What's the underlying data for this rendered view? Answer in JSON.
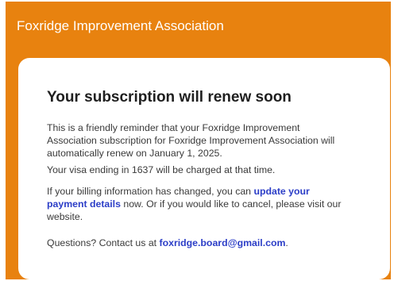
{
  "header": {
    "title": "Foxridge Improvement Association"
  },
  "card": {
    "title": "Your subscription will renew soon",
    "reminder": "This is a friendly reminder that your Foxridge Improvement Association subscription for Foxridge Improvement Association will automatically renew on January 1, 2025.",
    "charge_notice": "Your visa ending in 1637 will be charged at that time.",
    "billing": {
      "before_link": "If your billing information has changed, you can ",
      "link_label": "update your payment details",
      "after_link": " now. Or if you would like to cancel, please visit our website."
    },
    "questions": {
      "before_email": "Questions? Contact us at ",
      "email": "foxridge.board@gmail.com",
      "after_email": "."
    }
  },
  "colors": {
    "header_background": "#e8820f",
    "link": "#2c3ec7"
  }
}
